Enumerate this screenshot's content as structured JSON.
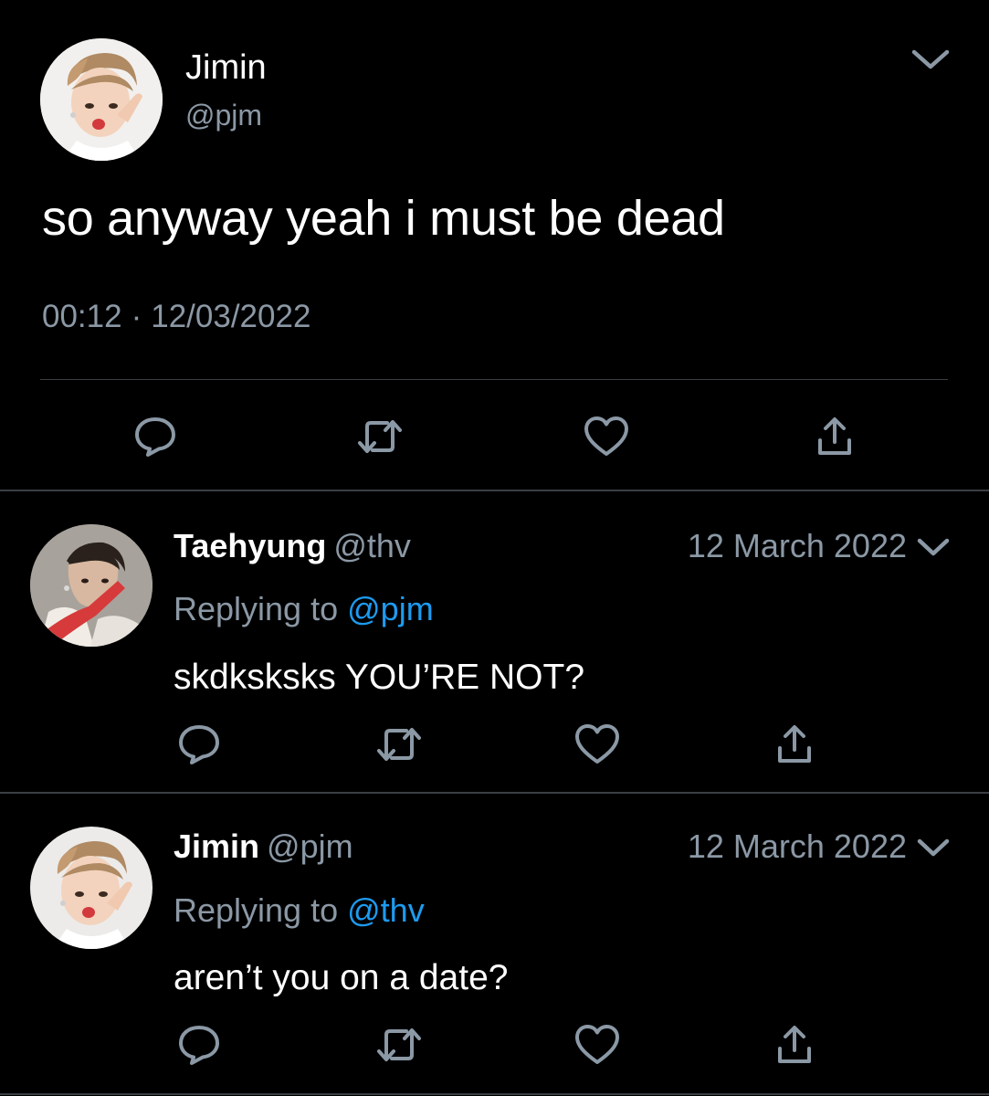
{
  "colors": {
    "background": "#000000",
    "text_primary": "#ffffff",
    "text_secondary": "#8b98a5",
    "divider": "#3a3f44",
    "mention": "#1d9bf0"
  },
  "main_tweet": {
    "name": "Jimin",
    "handle": "@pjm",
    "text": "so anyway yeah i must be dead",
    "time": "00:12",
    "separator": "·",
    "date": "12/03/2022",
    "avatar_icon": "avatar-jimin",
    "menu_icon": "chevron-down-icon",
    "actions": [
      "reply-icon",
      "retweet-icon",
      "like-icon",
      "share-icon"
    ]
  },
  "replies": [
    {
      "name": "Taehyung",
      "handle": "@thv",
      "date": "12 March 2022",
      "replying_label": "Replying to",
      "replying_to": "@pjm",
      "text": "skdksksks YOU’RE NOT?",
      "avatar_icon": "avatar-taehyung"
    },
    {
      "name": "Jimin",
      "handle": "@pjm",
      "date": "12 March 2022",
      "replying_label": "Replying to",
      "replying_to": "@thv",
      "text": "aren’t you on a date?",
      "avatar_icon": "avatar-jimin"
    }
  ]
}
